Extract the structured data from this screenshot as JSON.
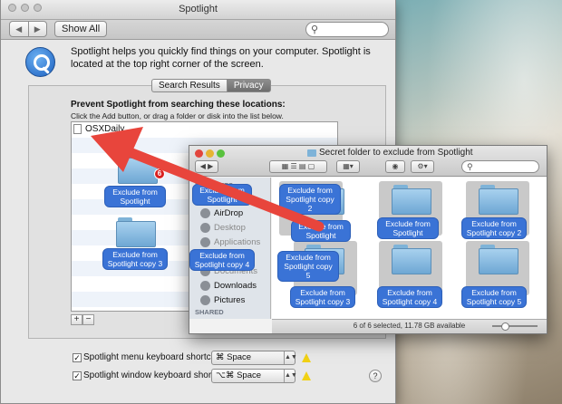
{
  "prefs": {
    "title": "Spotlight",
    "show_all": "Show All",
    "description": "Spotlight helps you quickly find things on your computer. Spotlight is located at the top right corner of the screen.",
    "tabs": [
      "Search Results",
      "Privacy"
    ],
    "prevent_heading": "Prevent Spotlight from searching these locations:",
    "hint": "Click the Add button, or drag a folder or disk into the list below.",
    "list_items": [
      "OSXDaily"
    ],
    "add": "+",
    "remove": "−",
    "menu_shortcut_label": "Spotlight menu keyboard shortcut:",
    "menu_shortcut_value": "⌘ Space",
    "window_shortcut_label": "Spotlight window keyboard shortcut:",
    "window_shortcut_value": "⌥⌘ Space",
    "help": "?"
  },
  "drag": {
    "badge": "6",
    "labels": [
      "Exclude from Spotlight",
      "Exclude from Spotlight copy 3",
      "Exclude from Spotlight copy 4"
    ]
  },
  "finder": {
    "title": "Secret folder to exclude from Spotlight",
    "search_placeholder": "",
    "sidebar": {
      "favorites_head": "FAVORITES",
      "items": [
        "AirDrop",
        "Desktop",
        "Applications",
        "Documents",
        "Downloads",
        "Pictures"
      ],
      "shared_head": "SHARED"
    },
    "folders": [
      {
        "label": "Exclude from Spotlight copy 2"
      },
      {
        "label": "Exclude from Spotlight"
      },
      {
        "label": "Exclude from Spotlight copy 2"
      },
      {
        "label": "Exclude from Spotlight"
      },
      {
        "label": "Exclude from Spotlight copy 3"
      },
      {
        "label": "Exclude from Spotlight copy 4"
      },
      {
        "label": "Exclude from Spotlight copy 5"
      }
    ],
    "overlay_labels": [
      "Exclude from Spotlight",
      "Spotlight copy 5"
    ],
    "status": "6 of 6 selected, 11.78 GB available"
  },
  "colors": {
    "selection": "#3a73d6",
    "arrow": "#e8453c",
    "warning": "#f1d114"
  }
}
